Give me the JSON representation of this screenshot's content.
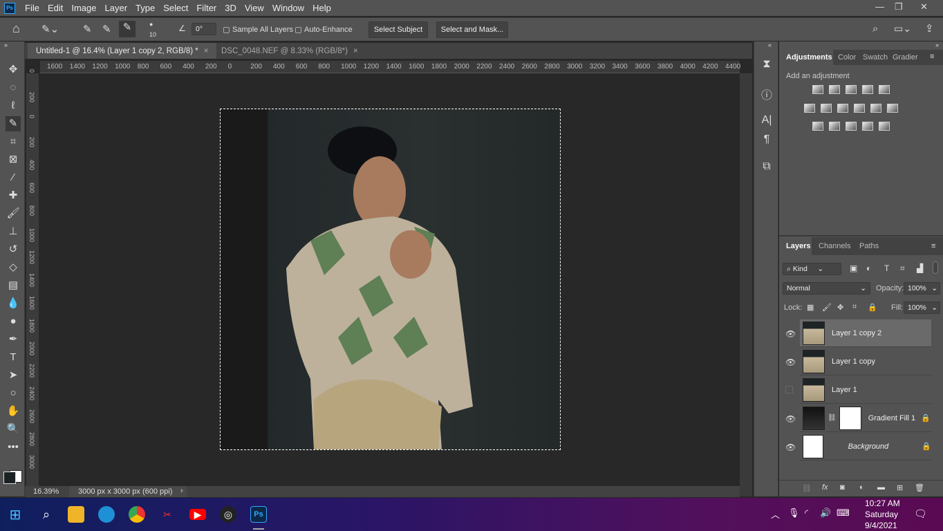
{
  "app": {
    "logo": "Ps",
    "menu": [
      "File",
      "Edit",
      "Image",
      "Layer",
      "Type",
      "Select",
      "Filter",
      "3D",
      "View",
      "Window",
      "Help"
    ]
  },
  "window_controls": {
    "minimize": "—",
    "restore": "❐",
    "close": "✕"
  },
  "options": {
    "brush_size": "10",
    "angle": "0°",
    "sample_all_layers": "Sample All Layers",
    "auto_enhance": "Auto-Enhance",
    "select_subject": "Select Subject",
    "select_and_mask": "Select and Mask..."
  },
  "tabs": [
    {
      "label": "Untitled-1 @ 16.4% (Layer 1 copy 2, RGB/8) *",
      "active": true
    },
    {
      "label": "DSC_0048.NEF @ 8.33% (RGB/8*)",
      "active": false
    }
  ],
  "hruler": [
    "1600",
    "1400",
    "1200",
    "1000",
    "800",
    "600",
    "400",
    "200",
    "0",
    "200",
    "400",
    "600",
    "800",
    "1000",
    "1200",
    "1400",
    "1600",
    "1800",
    "2000",
    "2200",
    "2400",
    "2600",
    "2800",
    "3000",
    "3200",
    "3400",
    "3600",
    "3800",
    "4000",
    "4200",
    "4400"
  ],
  "vruler": [
    "0",
    "200",
    "0",
    "200",
    "400",
    "600",
    "800",
    "1000",
    "1200",
    "1400",
    "1600",
    "1800",
    "2000",
    "2200",
    "2400",
    "2600",
    "2800",
    "3000"
  ],
  "status": {
    "zoom": "16.39%",
    "doc_info": "3000 px x 3000 px (600 ppi)"
  },
  "adjustments": {
    "tabs": [
      "Adjustments",
      "Color",
      "Swatch",
      "Gradier"
    ],
    "hint": "Add an adjustment"
  },
  "layers_panel": {
    "tabs": [
      "Layers",
      "Channels",
      "Paths"
    ],
    "kind": "Kind",
    "blend_mode": "Normal",
    "opacity_label": "Opacity:",
    "opacity": "100%",
    "lock_label": "Lock:",
    "fill_label": "Fill:",
    "fill": "100%",
    "layers": [
      {
        "name": "Layer 1 copy 2",
        "visible": true,
        "selected": true
      },
      {
        "name": "Layer 1 copy",
        "visible": true
      },
      {
        "name": "Layer 1",
        "visible": false
      },
      {
        "name": "Gradient Fill 1",
        "visible": true,
        "locked": true
      },
      {
        "name": "Background",
        "visible": true,
        "locked": true
      }
    ]
  },
  "taskbar": {
    "time": "10:27 AM",
    "day": "Saturday",
    "date": "9/4/2021"
  },
  "colors": {
    "accent": "#31a8ff",
    "foreground": "#1a2223",
    "background": "#ffffff"
  }
}
